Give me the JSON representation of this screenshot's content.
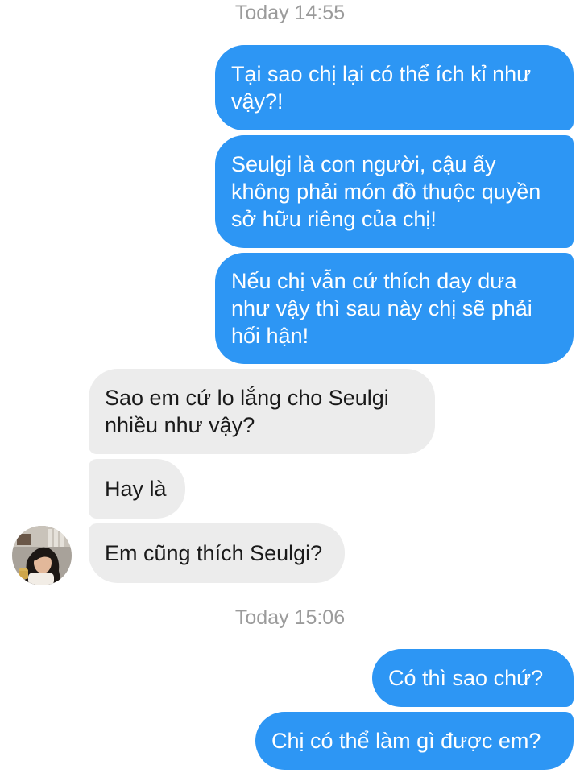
{
  "conversation": {
    "timestamp_1": "Today 14:55",
    "timestamp_2": "Today 15:06",
    "messages": [
      {
        "direction": "outgoing",
        "text": "Tại sao chị lại có thể ích kỉ như vậy?!"
      },
      {
        "direction": "outgoing",
        "text": "Seulgi là con người, cậu ấy không phải món đồ thuộc quyền sở hữu riêng của chị!"
      },
      {
        "direction": "outgoing",
        "text": "Nếu chị vẫn cứ thích day dưa như vậy thì sau này chị sẽ phải hối hận!"
      },
      {
        "direction": "incoming",
        "text": "Sao em cứ lo lắng cho Seulgi nhiều như vậy?"
      },
      {
        "direction": "incoming",
        "text": "Hay là"
      },
      {
        "direction": "incoming",
        "text": "Em cũng thích Seulgi?"
      },
      {
        "direction": "outgoing",
        "text": "Có thì sao chứ?"
      },
      {
        "direction": "outgoing",
        "text": "Chị có thể làm gì được em?"
      }
    ]
  },
  "colors": {
    "outgoing_bubble": "#2d96f4",
    "incoming_bubble": "#ececec",
    "timestamp_text": "#9b9b9b"
  },
  "icons": {
    "contact_avatar": "contact-avatar-photo"
  }
}
